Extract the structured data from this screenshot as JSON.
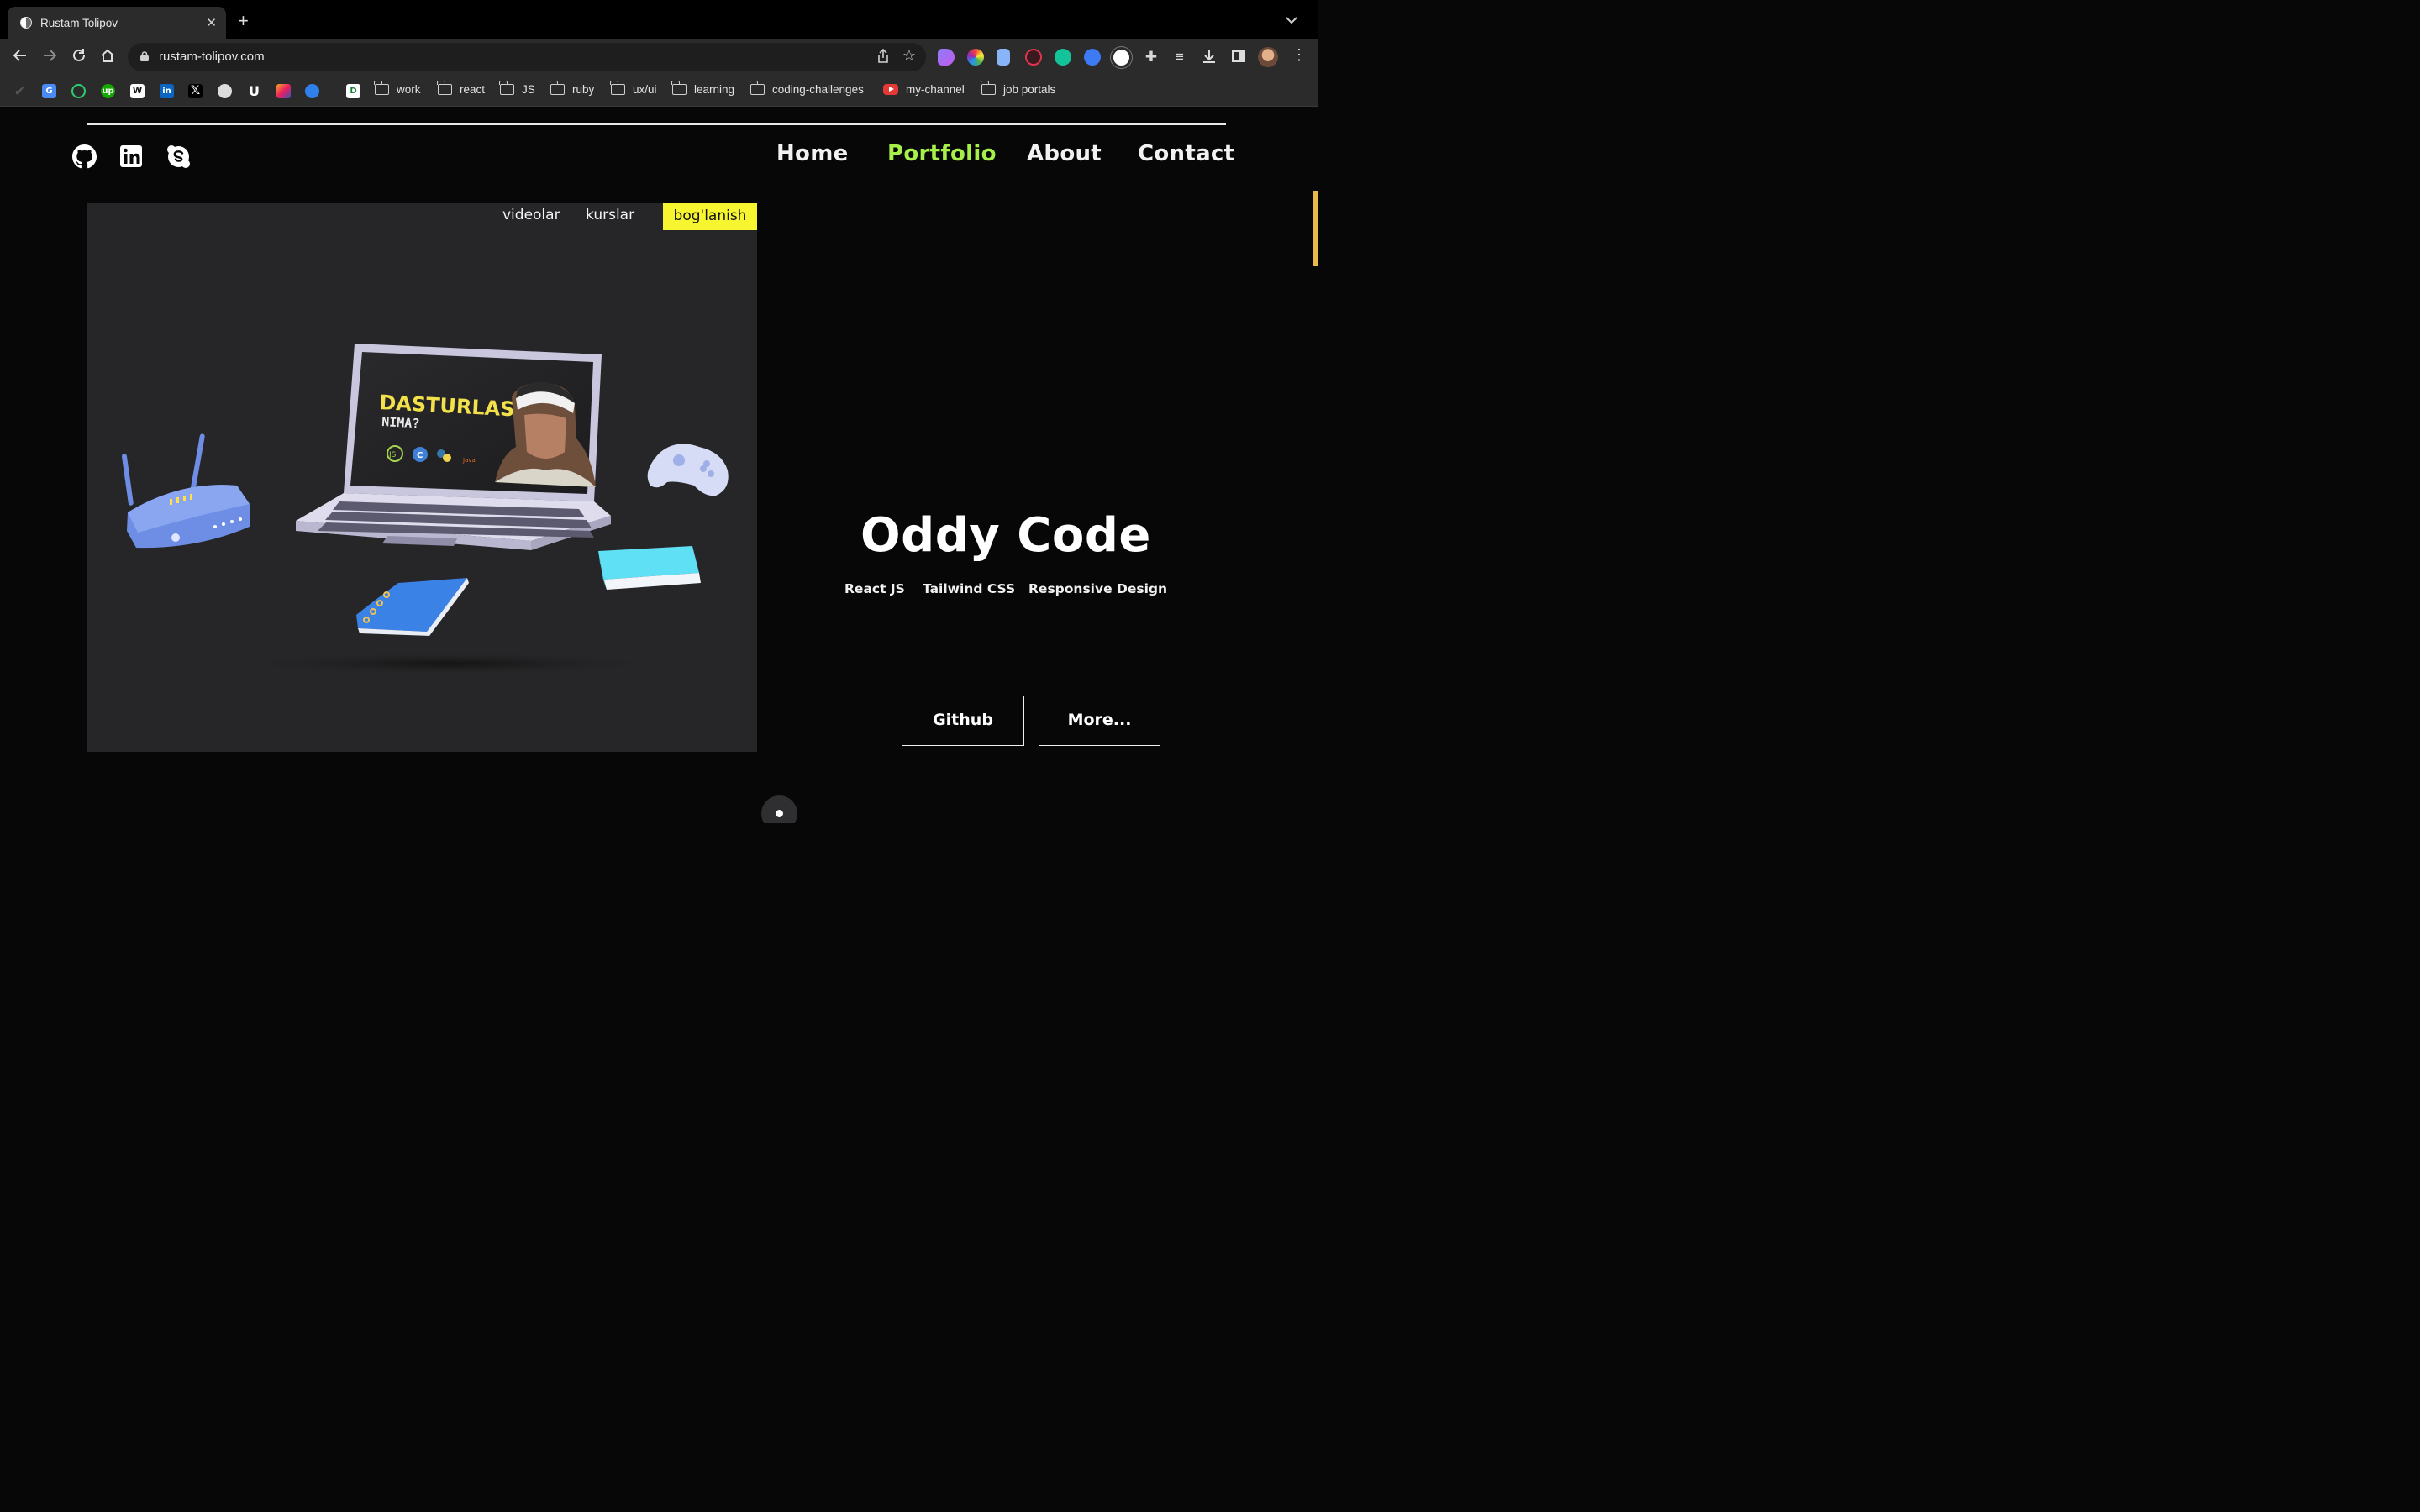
{
  "browser": {
    "tab_title": "Rustam Tolipov",
    "new_tab_symbol": "+",
    "close_symbol": "✕",
    "url": "rustam-tolipov.com",
    "bookmarks": [
      {
        "label": "work"
      },
      {
        "label": "react"
      },
      {
        "label": "JS"
      },
      {
        "label": "ruby"
      },
      {
        "label": "ux/ui"
      },
      {
        "label": "learning"
      },
      {
        "label": "coding-challenges"
      },
      {
        "label": "my-channel"
      },
      {
        "label": "job portals"
      }
    ],
    "bookmark_icon_letters": [
      "up",
      "W",
      "in",
      "U",
      "D"
    ]
  },
  "site": {
    "social": [
      "github-icon",
      "linkedin-icon",
      "skype-icon"
    ],
    "nav": [
      {
        "label": "Home",
        "active": false
      },
      {
        "label": "Portfolio",
        "active": true
      },
      {
        "label": "About",
        "active": false
      },
      {
        "label": "Contact",
        "active": false
      }
    ],
    "accent_color": "#a7f04a",
    "preview": {
      "links": [
        "videolar",
        "kurslar"
      ],
      "cta": "bog'lanish",
      "cta_color": "#f7f52f",
      "screen_title": "DASTURLASH",
      "screen_subtitle": "NIMA?",
      "screen_logo_text": [
        "JS",
        "C",
        "Java"
      ]
    },
    "project": {
      "title": "Oddy Code",
      "tech": [
        "React JS",
        "Tailwind CSS",
        "Responsive Design"
      ],
      "buttons": {
        "github": "Github",
        "more": "More..."
      }
    }
  }
}
